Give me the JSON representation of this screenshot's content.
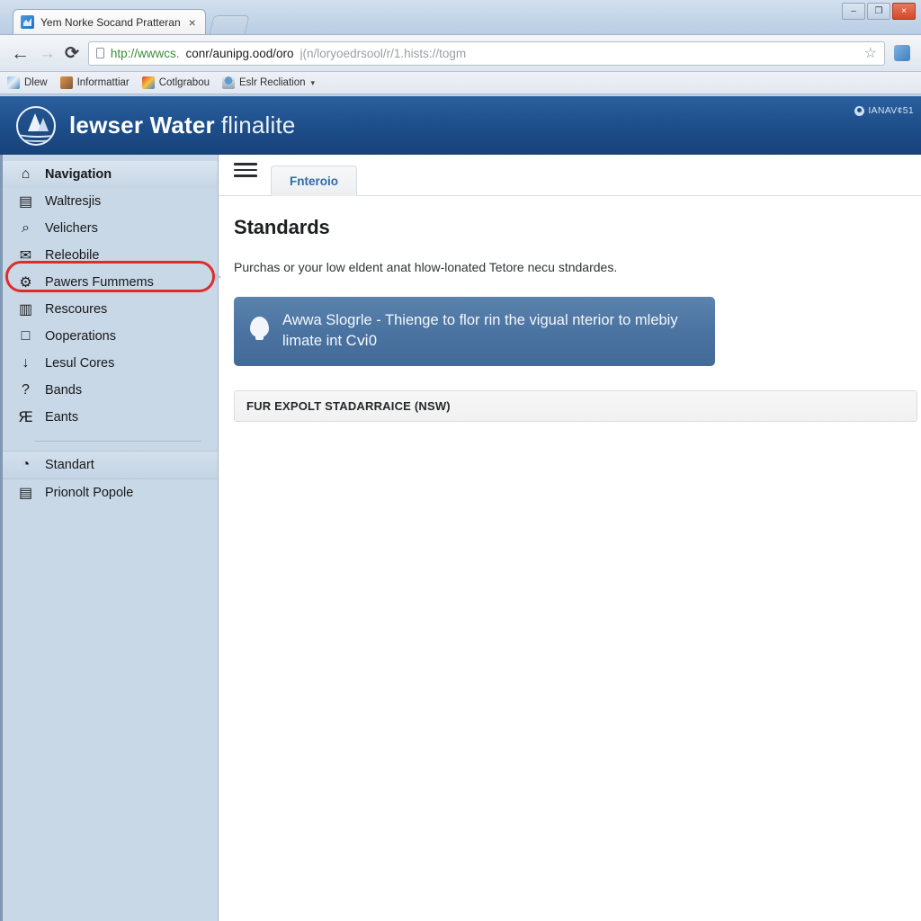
{
  "browser": {
    "tab": {
      "title": "Yem Norke Socand Pratteran",
      "close_label": "×"
    },
    "new_tab_label": "",
    "window": {
      "minimize": "–",
      "maximize": "❐",
      "close": "×"
    },
    "nav": {
      "back": "←",
      "forward": "→",
      "reload": "⟳"
    },
    "url": {
      "scheme": "htp://wwwcs.",
      "host": "conr/aunipg.ood/oro",
      "path": "j(n/loryoedrsool/r/1.hists://togm",
      "star": "☆"
    },
    "bookmarks": [
      {
        "label": "Dlew",
        "underline_first": true
      },
      {
        "label": "Informattiar",
        "underline_first": false
      },
      {
        "label": "Cotlgrabou",
        "underline_first": false
      },
      {
        "label": "Eslr Recliation",
        "underline_first": true,
        "caret": "▾"
      }
    ]
  },
  "app": {
    "brand_bold": "lewser Water",
    "brand_light": "flinalite",
    "account": "IANAV¢51"
  },
  "sidebar": {
    "items": [
      {
        "label": "Navigation",
        "icon": "lock-icon",
        "glyph": "⌂",
        "state": "active"
      },
      {
        "label": "Waltresjis",
        "icon": "card-icon",
        "glyph": "▤",
        "state": ""
      },
      {
        "label": "Velichers",
        "icon": "search-icon",
        "glyph": "⌕",
        "state": ""
      },
      {
        "label": "Releobile",
        "icon": "envelope-icon",
        "glyph": "✉",
        "state": ""
      },
      {
        "label": "Pawers Fummems",
        "icon": "gear-icon",
        "glyph": "⚙",
        "state": ""
      },
      {
        "label": "Rescoures",
        "icon": "archive-icon",
        "glyph": "▥",
        "state": ""
      },
      {
        "label": "Ooperations",
        "icon": "window-icon",
        "glyph": "□",
        "state": ""
      },
      {
        "label": "Lesul Cores",
        "icon": "download-icon",
        "glyph": "↓",
        "state": ""
      },
      {
        "label": "Bands",
        "icon": "question-icon",
        "glyph": "?",
        "state": ""
      },
      {
        "label": "Eants",
        "icon": "ribbon-icon",
        "glyph": "Ԙ",
        "state": ""
      }
    ],
    "secondary": [
      {
        "label": "Standart",
        "icon": "globe-icon",
        "glyph": "◔",
        "state": "selected"
      },
      {
        "label": "Prionolt Popole",
        "icon": "building-icon",
        "glyph": "▤",
        "state": ""
      }
    ]
  },
  "main": {
    "hamburger": "menu-icon",
    "tab_label": "Fnteroio",
    "title": "Standards",
    "description": "Purchas or your low eldent anat hlow-lonated Tetore necu stndardes.",
    "alert": {
      "icon": "bulb-icon",
      "text": "Awwa Slogrle - Thienge to flor rin the vigual nterior to mlebiy limate int Cⅵ0"
    },
    "list_rows": [
      {
        "label": "FUR EXPOLT STADARRAICE (NSW)"
      }
    ]
  },
  "colors": {
    "header_blue": "#1d4e8a",
    "alert_blue": "#4a72a0",
    "sidebar": "#c9d8e6",
    "highlight_ring": "#e02b2b",
    "tab_text": "#2f6aae"
  }
}
